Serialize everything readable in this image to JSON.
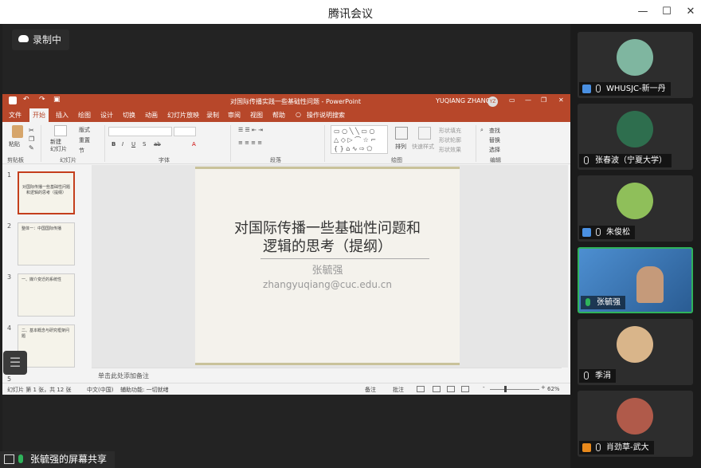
{
  "window": {
    "title": "腾讯会议",
    "min": "—",
    "max": "☐",
    "close": "✕"
  },
  "recording": {
    "label": "录制中",
    "icon": "cloud-icon"
  },
  "ppt": {
    "file_title": "对国际传播实践一些基础性问题 - PowerPoint",
    "user": "YUQIANG ZHANG",
    "user_initials": "YZ",
    "tabs": [
      "文件",
      "开始",
      "插入",
      "绘图",
      "设计",
      "切换",
      "动画",
      "幻灯片放映",
      "录制",
      "审阅",
      "视图",
      "帮助",
      "操作说明搜索"
    ],
    "active_tab": "开始",
    "ribbon": {
      "paste": "粘贴",
      "new_slide": "新建\n幻灯片",
      "layout": "版式",
      "reset": "重置",
      "section": "节",
      "arrange": "排列",
      "quick_styles": "快速样式",
      "shape_fill": "形状填充",
      "shape_outline": "形状轮廓",
      "shape_effects": "形状效果",
      "find": "查找",
      "replace": "替换",
      "select": "选择",
      "groups": [
        "剪贴板",
        "幻灯片",
        "字体",
        "段落",
        "绘图",
        "编辑"
      ]
    },
    "slide": {
      "title_line1": "对国际传播一些基础性问题和",
      "title_line2": "逻辑的思考（提纲）",
      "author": "张毓强",
      "email": "zhangyuqiang@cuc.edu.cn"
    },
    "thumb_numbers": [
      "1",
      "2",
      "3",
      "4",
      "5"
    ],
    "thumb_titles": [
      "对国际传播一些基础性问题和逻辑的思考（提纲）",
      "整体一：中国国际传播",
      "一、媒介变迁的系统性",
      "二、基本概念与研究框架问题"
    ],
    "notes_placeholder": "单击此处添加备注",
    "status": {
      "slide_count": "幻灯片 第 1 张，共 12 张",
      "language": "中文(中国)",
      "accessibility": "辅助功能: 一切就绪",
      "notes": "备注",
      "comments": "批注",
      "zoom": "62%",
      "zoom_minus": "-",
      "zoom_plus": "+"
    }
  },
  "share": {
    "label": "张毓强的屏幕共享"
  },
  "participants": [
    {
      "name": "WHUSJC-新一丹",
      "avatar_color": "#7fb6a0",
      "muted": true,
      "has_user_icon": true
    },
    {
      "name": "张春波（宁夏大学）",
      "avatar_color": "#2e6e4e",
      "muted": true,
      "has_user_icon": false
    },
    {
      "name": "朱俊松",
      "avatar_color": "#8fbf5a",
      "muted": true,
      "has_user_icon": true
    },
    {
      "name": "张毓强",
      "avatar_color": "#3a6fa8",
      "muted": false,
      "has_user_icon": false
    },
    {
      "name": "季涓",
      "avatar_color": "#d9b58a",
      "muted": true,
      "has_user_icon": false
    },
    {
      "name": "肖劲草-武大",
      "avatar_color": "#b05a4a",
      "muted": true,
      "has_user_icon": true
    }
  ]
}
